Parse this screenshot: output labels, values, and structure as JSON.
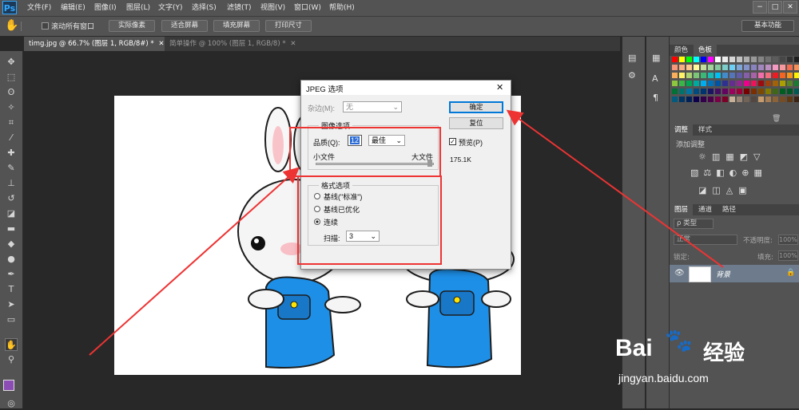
{
  "app": {
    "logo": "Ps",
    "menu": [
      "文件(F)",
      "编辑(E)",
      "图像(I)",
      "图层(L)",
      "文字(Y)",
      "选择(S)",
      "滤镜(T)",
      "视图(V)",
      "窗口(W)",
      "帮助(H)"
    ],
    "window_controls": [
      "−",
      "□",
      "✕"
    ]
  },
  "options_bar": {
    "scroll_all_label": "滚动所有窗口",
    "buttons": [
      "实际像素",
      "适合屏幕",
      "填充屏幕",
      "打印尺寸"
    ],
    "workspace": "基本功能"
  },
  "tabs": [
    {
      "label": "timg.jpg @ 66.7% (图层 1, RGB/8#) *",
      "close": "✕",
      "active": true
    },
    {
      "label": "简单操作 @ 100% (图层 1, RGB/8) *",
      "close": "✕",
      "active": false
    }
  ],
  "dialog": {
    "title": "JPEG 选项",
    "close": "✕",
    "matte_label": "杂边(M):",
    "matte_value": "无",
    "image_options_label": "图像选项",
    "quality_label": "品质(Q):",
    "quality_value": "12",
    "quality_preset": "最佳",
    "small_file": "小文件",
    "large_file": "大文件",
    "slider_level": 1.0,
    "format_options_label": "格式选项",
    "format_options": [
      "基线(\"标准\")",
      "基线已优化",
      "连续"
    ],
    "selected_format": 2,
    "scans_label": "扫描:",
    "scans_value": "3",
    "ok": "确定",
    "reset": "复位",
    "preview_label": "预览(P)",
    "preview_checked": true,
    "file_size": "175.1K"
  },
  "right_panel": {
    "color_tabs": [
      "颜色",
      "色板"
    ],
    "adjust_tabs": [
      "调整",
      "样式"
    ],
    "adjust_title": "添加调整",
    "layer_tabs": [
      "图层",
      "通道",
      "路径"
    ],
    "kind_label": "ρ 类型",
    "blend_mode": "正常",
    "opacity_label": "不透明度:",
    "opacity_value": "100%",
    "lock_label": "锁定:",
    "fill_label": "填充:",
    "fill_value": "100%",
    "layer_name": "背景"
  },
  "watermark": {
    "brand": "Bai",
    "brand2": "经验",
    "url": "jingyan.baidu.com"
  },
  "colors": {
    "ui_dark": "#535353",
    "accent_red": "#ee3333",
    "rabbit_blue": "#1e8fe6"
  }
}
